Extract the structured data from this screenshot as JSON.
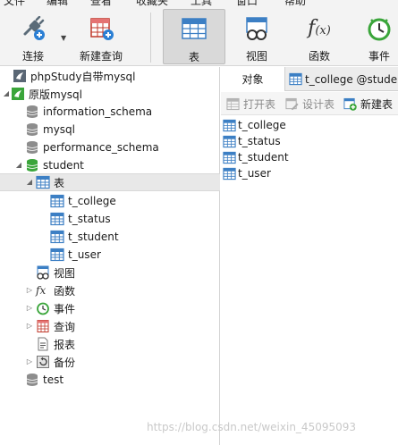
{
  "menu": [
    "文件",
    "编辑",
    "查看",
    "收藏夹",
    "工具",
    "窗口",
    "帮助"
  ],
  "toolbar": {
    "connect_label": "连接",
    "new_query_label": "新建查询",
    "table_label": "表",
    "view_label": "视图",
    "function_label": "函数",
    "event_label": "事件"
  },
  "tree": {
    "connections": [
      {
        "label": "phpStudy自带mysql"
      },
      {
        "label": "原版mysql"
      }
    ],
    "databases": [
      "information_schema",
      "mysql",
      "performance_schema",
      "student",
      "test"
    ],
    "table_group_label": "表",
    "tables": [
      "t_college",
      "t_status",
      "t_student",
      "t_user"
    ],
    "other_groups": [
      "视图",
      "函数",
      "事件",
      "查询",
      "报表",
      "备份"
    ]
  },
  "right": {
    "tab_objects": "对象",
    "tab_table": "t_college @stude",
    "open_table": "打开表",
    "design_table": "设计表",
    "new_table": "新建表",
    "items": [
      "t_college",
      "t_status",
      "t_student",
      "t_user"
    ]
  },
  "watermark": "https://blog.csdn.net/weixin_45095093",
  "colors": {
    "accent_green": "#3aa53a",
    "table_blue": "#3c7fc4",
    "selected_bg": "#e8e8e8"
  }
}
